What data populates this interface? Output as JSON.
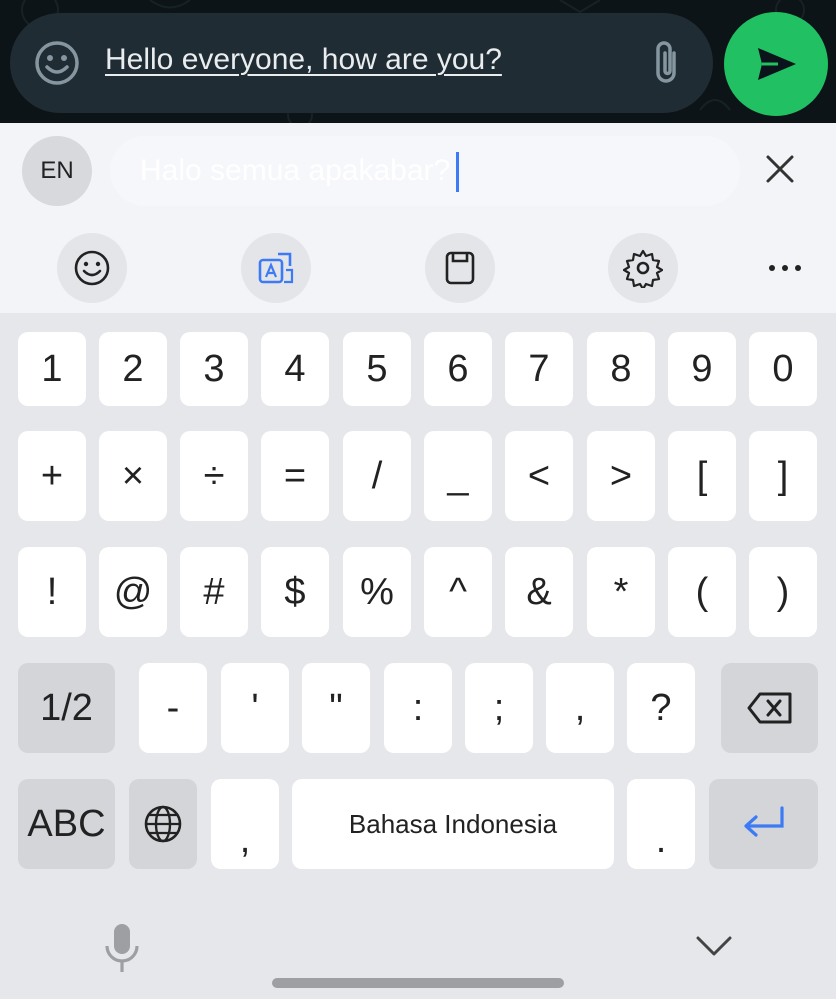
{
  "chat": {
    "message_text": "Hello everyone, how are you?",
    "icons": {
      "emoji": "emoji-icon",
      "attach": "paperclip-icon",
      "send": "send-icon"
    },
    "colors": {
      "send_button": "#21c063",
      "background": "#0d1418",
      "pill": "#202c33"
    }
  },
  "translator": {
    "language_code": "EN",
    "translated_text": "Halo semua apakabar?",
    "close_icon": "close-icon",
    "caret_color": "#3d7bf5"
  },
  "toolbar": {
    "items": [
      "emoji-icon",
      "translate-icon",
      "clipboard-icon",
      "settings-icon",
      "more-icon"
    ]
  },
  "keyboard": {
    "row1": [
      "1",
      "2",
      "3",
      "4",
      "5",
      "6",
      "7",
      "8",
      "9",
      "0"
    ],
    "row2": [
      "+",
      "×",
      "÷",
      "=",
      "/",
      "_",
      "<",
      ">",
      "[",
      "]"
    ],
    "row3": [
      "!",
      "@",
      "#",
      "$",
      "%",
      "^",
      "&",
      "*",
      "(",
      ")"
    ],
    "row4": {
      "page_toggle": "1/2",
      "keys": [
        "-",
        "'",
        "\"",
        ":",
        ";",
        ",",
        "?"
      ],
      "backspace_icon": "backspace-icon"
    },
    "row5": {
      "abc": "ABC",
      "globe_icon": "globe-icon",
      "comma": ",",
      "space_label": "Bahasa Indonesia",
      "period": ".",
      "enter_icon": "enter-icon"
    },
    "bottom": {
      "mic_icon": "mic-icon",
      "hide_icon": "chevron-down-icon"
    }
  }
}
